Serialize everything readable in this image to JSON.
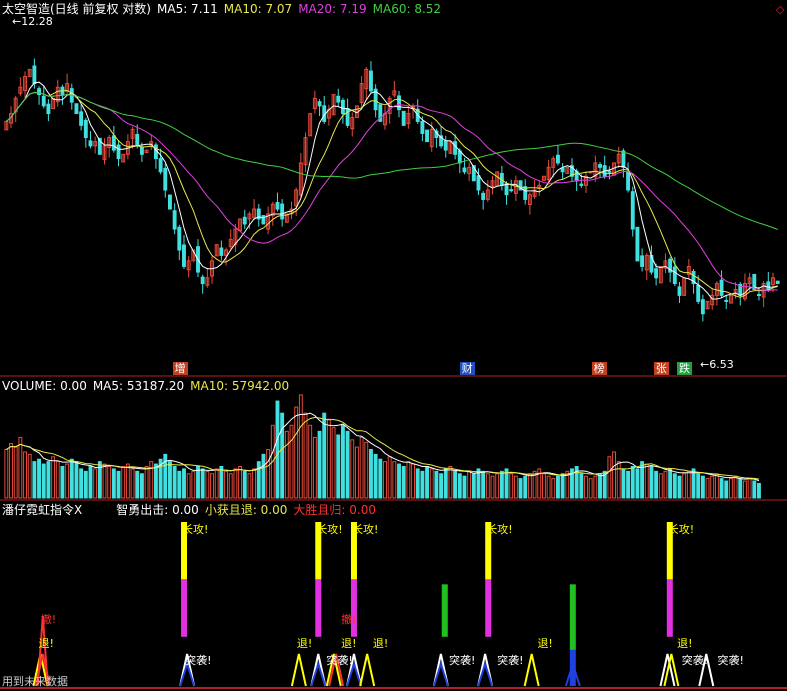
{
  "main_header": {
    "title": "太空智造(日线 前复权 对数)",
    "ma5": "MA5: 7.11",
    "ma10": "MA10: 7.07",
    "ma20": "MA20: 7.19",
    "ma60": "MA60: 8.52",
    "colors": {
      "title": "#ffffff",
      "ma5": "#ffffff",
      "ma10": "#e8e84a",
      "ma20": "#e040e0",
      "ma60": "#40d040"
    }
  },
  "volume_header": {
    "label": "VOLUME: 0.00",
    "ma5": "MA5: 53187.20",
    "ma10": "MA10: 57942.00"
  },
  "indicator_header": {
    "name": "潘仔霓虹指令X",
    "zhiyong": "智勇出击: 0.00",
    "xiaohuo": "小获且退: 0.00",
    "dasheng": "大胜且归: 0.00"
  },
  "high_label": "12.28",
  "low_label": "6.53",
  "event_tags": [
    {
      "text": "增",
      "bg": "#c04020",
      "pos": 0.225
    },
    {
      "text": "财",
      "bg": "#2050c0",
      "pos": 0.595
    },
    {
      "text": "榜",
      "bg": "#c04020",
      "pos": 0.765
    },
    {
      "text": "张",
      "bg": "#c04020",
      "pos": 0.845
    },
    {
      "text": "跌",
      "bg": "#20a040",
      "pos": 0.875
    }
  ],
  "signal_labels": {
    "attack": "长攻!",
    "raid": "突袭!",
    "retreat": "退!",
    "exit": "撤!"
  },
  "bottom_text": "用到未来数据",
  "chart_data": {
    "type": "candlestick",
    "title": "太空智造(日线 前复权 对数)",
    "y_scale": "log",
    "ylim": [
      6.0,
      13.5
    ],
    "high": 12.28,
    "low": 6.53,
    "series": [
      {
        "name": "MA5",
        "color": "#ffffff"
      },
      {
        "name": "MA10",
        "color": "#e8e84a"
      },
      {
        "name": "MA20",
        "color": "#e040e0"
      },
      {
        "name": "MA60",
        "color": "#40d040"
      }
    ],
    "closes": [
      10.6,
      10.8,
      11.2,
      11.5,
      11.8,
      12.0,
      11.6,
      11.3,
      11.0,
      10.8,
      11.2,
      11.5,
      11.3,
      11.6,
      11.1,
      10.8,
      10.5,
      10.2,
      10.0,
      10.1,
      9.8,
      10.0,
      10.2,
      9.9,
      9.7,
      9.8,
      10.1,
      10.4,
      10.0,
      9.8,
      9.9,
      10.1,
      9.7,
      9.4,
      9.0,
      8.6,
      8.2,
      7.8,
      7.5,
      7.6,
      7.8,
      7.4,
      7.2,
      7.3,
      7.6,
      7.9,
      7.7,
      7.8,
      8.0,
      8.2,
      8.4,
      8.3,
      8.5,
      8.6,
      8.4,
      8.3,
      8.5,
      8.7,
      8.6,
      8.4,
      8.5,
      8.6,
      9.0,
      9.6,
      10.2,
      10.8,
      11.2,
      11.0,
      10.6,
      10.9,
      11.3,
      11.1,
      10.8,
      10.5,
      10.7,
      11.0,
      11.6,
      12.0,
      11.4,
      10.9,
      10.6,
      10.8,
      11.2,
      11.4,
      10.9,
      10.5,
      10.8,
      11.0,
      10.6,
      10.3,
      10.1,
      10.4,
      10.2,
      10.0,
      9.9,
      10.1,
      9.8,
      9.6,
      9.4,
      9.5,
      9.2,
      9.0,
      8.8,
      9.0,
      9.2,
      9.4,
      9.1,
      8.9,
      9.0,
      9.2,
      9.0,
      8.8,
      8.9,
      9.0,
      9.1,
      9.3,
      9.5,
      9.7,
      9.6,
      9.4,
      9.5,
      9.3,
      9.2,
      9.1,
      9.3,
      9.4,
      9.6,
      9.5,
      9.3,
      9.4,
      9.6,
      9.8,
      9.5,
      9.0,
      8.2,
      7.6,
      7.5,
      7.7,
      7.4,
      7.3,
      7.5,
      7.6,
      7.4,
      7.2,
      7.0,
      7.3,
      7.5,
      7.2,
      6.9,
      6.7,
      6.9,
      7.0,
      7.2,
      7.0,
      6.9,
      7.0,
      7.1,
      7.0,
      7.2,
      7.3,
      7.1,
      7.0,
      7.2,
      7.1,
      7.3,
      7.2
    ],
    "volume": [
      40,
      45,
      42,
      50,
      38,
      36,
      30,
      32,
      28,
      30,
      34,
      30,
      26,
      28,
      32,
      30,
      24,
      22,
      26,
      24,
      30,
      28,
      26,
      24,
      22,
      26,
      28,
      24,
      22,
      20,
      26,
      30,
      28,
      32,
      36,
      30,
      26,
      22,
      24,
      20,
      22,
      26,
      24,
      22,
      20,
      24,
      26,
      22,
      20,
      24,
      26,
      22,
      20,
      24,
      30,
      36,
      40,
      60,
      80,
      70,
      55,
      60,
      75,
      85,
      70,
      60,
      50,
      55,
      70,
      65,
      58,
      52,
      60,
      55,
      48,
      42,
      50,
      46,
      40,
      36,
      32,
      30,
      34,
      30,
      28,
      26,
      30,
      28,
      24,
      22,
      26,
      24,
      22,
      20,
      24,
      26,
      22,
      20,
      18,
      22,
      20,
      24,
      22,
      20,
      18,
      20,
      22,
      24,
      20,
      18,
      16,
      18,
      20,
      22,
      24,
      20,
      18,
      16,
      18,
      20,
      22,
      24,
      26,
      20,
      18,
      16,
      18,
      20,
      22,
      34,
      38,
      30,
      24,
      22,
      26,
      24,
      30,
      28,
      26,
      22,
      20,
      22,
      24,
      20,
      18,
      20,
      22,
      24,
      20,
      18,
      16,
      18,
      20,
      16,
      14,
      16,
      18,
      16,
      14,
      16,
      14,
      12
    ],
    "volume_ma_labels": [
      "MA5",
      "MA10"
    ]
  }
}
